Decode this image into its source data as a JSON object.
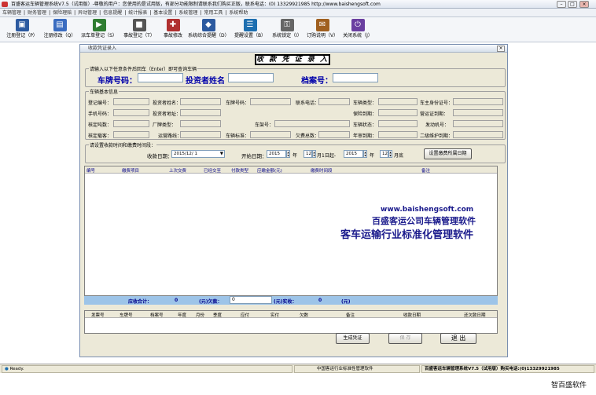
{
  "window": {
    "title": "百盛客运车辆管理系统V7.5（试用版）-尊敬的用户：您使用的是试用版，有部分功能限制请联系我们购买正版，联系电话：(0) 13329921985   http://www.baishengsoft.com",
    "min": "–",
    "max": "□",
    "close": "×"
  },
  "menu": [
    "车辆管理",
    "财务管理",
    "保险理赔",
    "异动管理",
    "信息提醒",
    "统计报表",
    "基本设置",
    "系统管理",
    "常用工具",
    "系统帮助"
  ],
  "toolbar": [
    {
      "label": "注册登记（P）",
      "icon": "register-icon",
      "color": "#2c5aa0",
      "glyph": "▣"
    },
    {
      "label": "注册修改（Q）",
      "icon": "edit-register-icon",
      "color": "#3a6cc0",
      "glyph": "▤"
    },
    {
      "label": "派车单登记（S）",
      "icon": "dispatch-icon",
      "color": "#2f7d32",
      "glyph": "▶"
    },
    {
      "label": "事故登记（T）",
      "icon": "accident-icon",
      "color": "#555555",
      "glyph": "■"
    },
    {
      "label": "事故修改",
      "icon": "accident-edit-icon",
      "color": "#b03030",
      "glyph": "✚"
    },
    {
      "label": "系统综合提醒（D）",
      "icon": "reminder-icon",
      "color": "#2c5aa0",
      "glyph": "◆"
    },
    {
      "label": "提醒设置（B）",
      "icon": "reminder-settings-icon",
      "color": "#1e6fb0",
      "glyph": "☰"
    },
    {
      "label": "系统锁定（I）",
      "icon": "lock-icon",
      "color": "#666666",
      "glyph": "⚿"
    },
    {
      "label": "订购说明（V）",
      "icon": "order-info-icon",
      "color": "#a06020",
      "glyph": "✉"
    },
    {
      "label": "关闭系统（J）",
      "icon": "shutdown-icon",
      "color": "#6a3fa0",
      "glyph": "⏻"
    }
  ],
  "form": {
    "window_title": "收款凭证录入",
    "window_close": "×",
    "heading": "收 款 凭 证 录 入",
    "query_group": "请输入以下任意条件后回车（Enter）即可查询车辆",
    "plate_label": "车牌号码：",
    "investor_label": "投资者姓名",
    "file_label": "档案号：",
    "vehicle_group": "车辆基本信息",
    "vehicle_fields": [
      "登记编号：",
      "投资者姓名：",
      "车牌号码：",
      "联系电话：",
      "车辆类型：",
      "车主身份证号：",
      "手机号码：",
      "投资者地址：",
      "保险到期：",
      "营运证到期：",
      "核定吨数：",
      "厂牌类型：",
      "车架号：",
      "车辆状态：",
      "发动机号：",
      "核定载客：",
      "运营路线：",
      "车辆标准：",
      "欠费总数：",
      "年审到期：",
      "二级维护到期："
    ],
    "period_group": "请设置收款时间和缴费时间段：",
    "pay_date_label": "收款日期：",
    "pay_date": "2015/12/ 1",
    "start_label": "开始日期：",
    "start_year": "2015",
    "year_unit": "年",
    "start_month": "12",
    "start_day_text": "月1日起-",
    "end_year": "2015",
    "end_month": "12",
    "end_suffix": "月底",
    "set_button": "设置缴费所属日期",
    "columns": [
      "编号",
      "缴费项目",
      "上次交费",
      "已经交至",
      "付款类型",
      "应缴金额(元)",
      "缴费时间段",
      "备注"
    ],
    "totals": {
      "due_label": "应收合计：",
      "due": "0",
      "unit1": "(元)欠款：",
      "debt": "0",
      "unit2": "(元)实收：",
      "paid": "0",
      "unit3": "(元)"
    },
    "columns2": [
      "发票号",
      "车牌号",
      "档案号",
      "年度",
      "月份",
      "季度",
      "应付",
      "实付",
      "欠数",
      "备注",
      "收款日期",
      "还欠款日期"
    ],
    "buttons": {
      "generate": "生成凭证",
      "save": "保 存",
      "exit": "退 出"
    }
  },
  "brand": {
    "url": "www.baishengsoft.com",
    "line1": "百盛客运公司车辆管理软件",
    "line2": "客车运输行业标准化管理软件"
  },
  "status": {
    "ready": "Ready.",
    "center": "中国客运行业标准性管理软件",
    "product": "百盛客运车辆管理系统V7.5（试用版）购买电话:(0)13329921985"
  },
  "footer_text": "智百盛软件"
}
